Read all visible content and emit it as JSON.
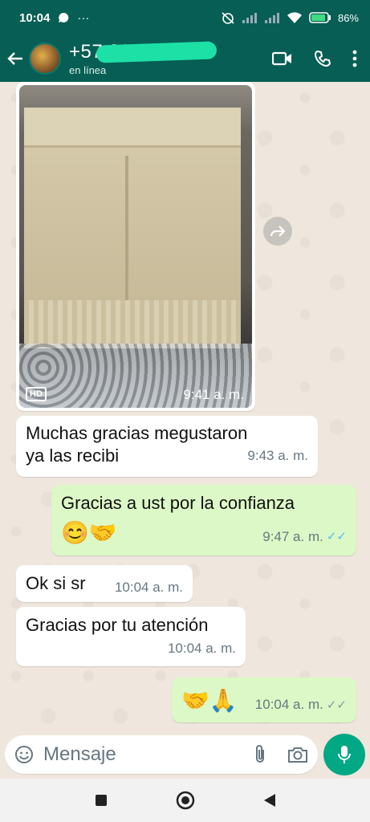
{
  "status_bar": {
    "time": "10:04",
    "more": "···",
    "battery": "86%"
  },
  "header": {
    "contact_name": "+57          221750",
    "contact_status": "en línea"
  },
  "messages": [
    {
      "type": "image",
      "badge": "HD",
      "time": "9:41 a. m."
    },
    {
      "type": "text",
      "direction": "in",
      "lines": [
        "Muchas gracias  megustaron",
        "ya las recibi"
      ],
      "time": "9:43 a. m."
    },
    {
      "type": "text",
      "direction": "out",
      "text": "Gracias a ust por la confianza",
      "emoji": "😊🤝",
      "time": "9:47 a. m.",
      "ticks": "✓✓"
    },
    {
      "type": "text",
      "direction": "in",
      "text": "Ok si sr",
      "time": "10:04 a. m."
    },
    {
      "type": "text",
      "direction": "in",
      "text": "Gracias por tu atención",
      "time": "10:04 a. m."
    },
    {
      "type": "text",
      "direction": "out",
      "emoji": "🤝🙏",
      "time": "10:04 a. m.",
      "ticks": "✓✓"
    }
  ],
  "input": {
    "placeholder": "Mensaje"
  },
  "icons": {
    "back": "arrow-left-icon",
    "video": "video-call-icon",
    "call": "phone-icon",
    "menu": "more-vert-icon",
    "emoji": "emoji-icon",
    "attach": "paperclip-icon",
    "camera": "camera-icon",
    "mic": "microphone-icon",
    "forward": "forward-icon"
  },
  "colors": {
    "header": "#075e54",
    "outgoing_bubble": "#dcf8c6",
    "incoming_bubble": "#ffffff",
    "read_ticks": "#53bdeb",
    "mic_button": "#00a884"
  }
}
